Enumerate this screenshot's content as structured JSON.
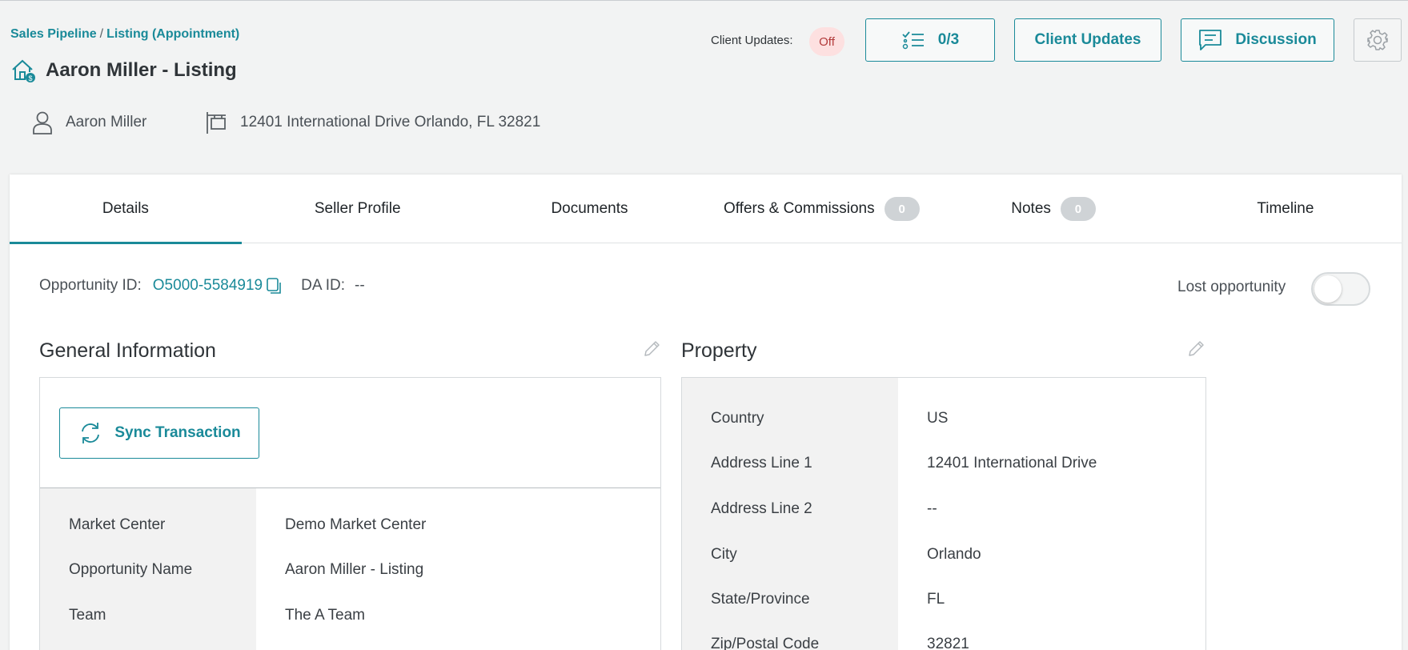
{
  "breadcrumb": {
    "parent": "Sales Pipeline",
    "separator": "/",
    "current": "Listing (Appointment)"
  },
  "page_title": "Aaron Miller - Listing",
  "contact_name": "Aaron Miller",
  "address": "12401 International Drive Orlando, FL 32821",
  "header_actions": {
    "client_updates_label": "Client Updates:",
    "client_updates_status": "Off",
    "checklist_count": "0/3",
    "client_updates_button": "Client Updates",
    "discussion_button": "Discussion"
  },
  "tabs": [
    {
      "label": "Details",
      "count": null
    },
    {
      "label": "Seller Profile",
      "count": null
    },
    {
      "label": "Documents",
      "count": null
    },
    {
      "label": "Offers & Commissions",
      "count": "0"
    },
    {
      "label": "Notes",
      "count": "0"
    },
    {
      "label": "Timeline",
      "count": null
    }
  ],
  "details": {
    "opportunity_id_label": "Opportunity ID:",
    "opportunity_id": "O5000-5584919",
    "da_id_label": "DA ID:",
    "da_id": "--",
    "lost_opportunity_label": "Lost opportunity",
    "lost_opportunity_on": false
  },
  "general_information": {
    "title": "General Information",
    "sync_button": "Sync Transaction",
    "rows": [
      {
        "label": "Market Center",
        "value": "Demo Market Center"
      },
      {
        "label": "Opportunity Name",
        "value": "Aaron Miller - Listing"
      },
      {
        "label": "Team",
        "value": "The A Team"
      }
    ]
  },
  "property": {
    "title": "Property",
    "rows": [
      {
        "label": "Country",
        "value": "US"
      },
      {
        "label": "Address Line 1",
        "value": "12401 International Drive"
      },
      {
        "label": "Address Line 2",
        "value": "--"
      },
      {
        "label": "City",
        "value": "Orlando"
      },
      {
        "label": "State/Province",
        "value": "FL"
      },
      {
        "label": "Zip/Postal Code",
        "value": "32821"
      }
    ]
  },
  "colors": {
    "accent": "#1a8a99",
    "off_badge_bg": "#fde0e0",
    "off_badge_text": "#b23a3a"
  },
  "icons": [
    "home-dollar-icon",
    "person-icon",
    "signpost-icon",
    "checklist-icon",
    "chat-icon",
    "gear-icon",
    "copy-icon",
    "pencil-icon",
    "sync-icon"
  ]
}
